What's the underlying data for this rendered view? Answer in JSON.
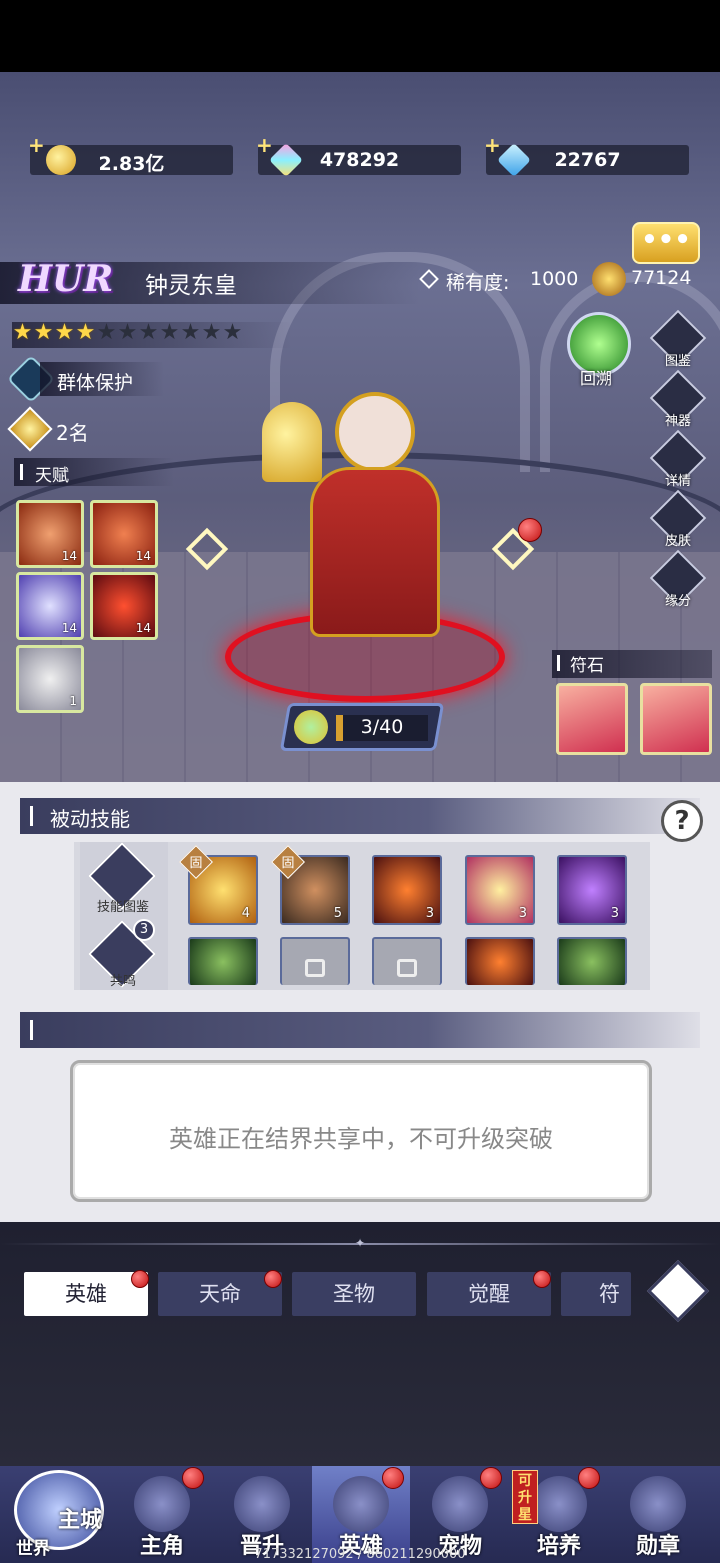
{
  "resources": [
    {
      "icon": "gold-coin-icon",
      "value": "2.83亿"
    },
    {
      "icon": "rainbow-gem-icon",
      "value": "478292"
    },
    {
      "icon": "blue-diamond-icon",
      "value": "22767"
    }
  ],
  "hero": {
    "grade": "HUR",
    "name": "钟灵东皇",
    "rarity_label": "稀有度:",
    "rarity_value": "1000",
    "power": "77124",
    "stars_filled": 4,
    "stars_total": 11,
    "trait": "群体保护",
    "rank": "2名",
    "level_progress": "3/40",
    "talent_label": "天赋",
    "rune_label": "符石",
    "rollback_label": "回溯"
  },
  "talents": [
    {
      "level": "14"
    },
    {
      "level": "14"
    },
    {
      "level": "14"
    },
    {
      "level": "14"
    },
    {
      "level": "1"
    }
  ],
  "side_buttons": [
    "图鉴",
    "神器",
    "详情",
    "皮肤",
    "缘分"
  ],
  "passive": {
    "title": "被动技能",
    "help_label": "?",
    "catalog_label": "技能图鉴",
    "resonance_label": "共鸣",
    "resonance_count": "3",
    "fixed_label": "固",
    "skills_row1": [
      {
        "level": "4",
        "fixed": true
      },
      {
        "level": "5",
        "fixed": true
      },
      {
        "level": "3",
        "fixed": false
      },
      {
        "level": "3",
        "fixed": false
      },
      {
        "level": "3",
        "fixed": false
      }
    ]
  },
  "breakthrough": {
    "message": "英雄正在结界共享中，不可升级突破"
  },
  "tabs": [
    {
      "label": "英雄",
      "dot": true,
      "active": true
    },
    {
      "label": "天命",
      "dot": true,
      "active": false
    },
    {
      "label": "圣物",
      "dot": false,
      "active": false
    },
    {
      "label": "觉醒",
      "dot": true,
      "active": false
    },
    {
      "label": "符文",
      "dot": false,
      "active": false
    }
  ],
  "nav": {
    "city_label": "主城",
    "world_label": "世界",
    "items": [
      "主角",
      "晋升",
      "英雄",
      "宠物",
      "培养",
      "勋章"
    ],
    "upgrade_star_badge": "可升星"
  },
  "footer_id": "717332127092 / 860211290000",
  "colors": {
    "accent": "#3a3e62",
    "gold": "#ffd84a",
    "red_dot": "#c01010"
  }
}
